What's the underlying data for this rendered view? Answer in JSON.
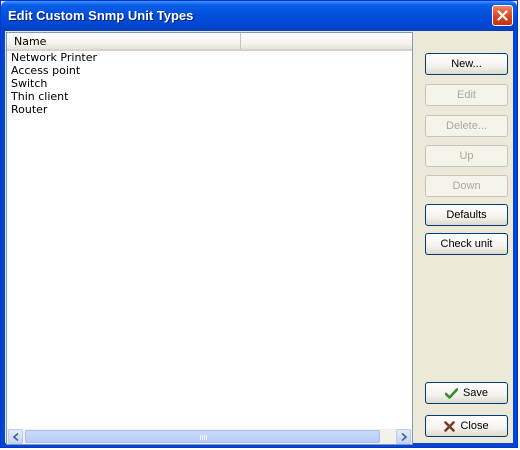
{
  "window": {
    "title": "Edit Custom Snmp Unit Types"
  },
  "list": {
    "columns": [
      "Name"
    ],
    "items": [
      "Network Printer",
      "Access point",
      "Switch",
      "Thin client",
      "Router"
    ]
  },
  "buttons": {
    "new": "New...",
    "edit": "Edit",
    "delete": "Delete...",
    "up": "Up",
    "down": "Down",
    "defaults": "Defaults",
    "check_unit": "Check unit",
    "save": "Save",
    "close": "Close"
  },
  "state": {
    "disabled": [
      "edit",
      "delete",
      "up",
      "down"
    ]
  },
  "icons": {
    "save": "checkmark-icon",
    "close": "x-icon",
    "title_close": "close-icon"
  },
  "colors": {
    "titlebar": "#0050dc",
    "window_frame": "#0047d1",
    "save_check": "#3a8e28",
    "close_x": "#7a3a2c"
  }
}
